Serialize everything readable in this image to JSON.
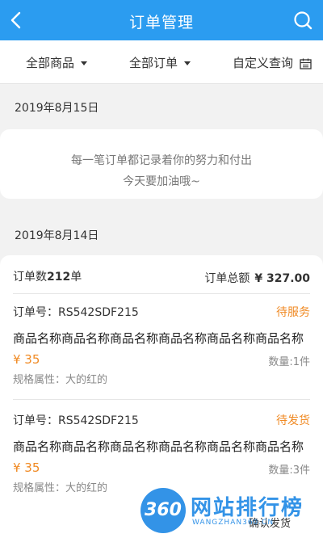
{
  "header": {
    "title": "订单管理"
  },
  "filter": {
    "products": "全部商品",
    "orders": "全部订单",
    "custom_query": "自定义查询"
  },
  "section1": {
    "date": "2019年8月15日",
    "motto_line1": "每一笔订单都记录着你的努力和付出",
    "motto_line2": "今天要加油哦~"
  },
  "section2": {
    "date": "2019年8月14日",
    "summary": {
      "count_label": "订单数",
      "count_value": "212",
      "count_unit": "单",
      "total_label": "订单总额",
      "total_value": "¥ 327.00"
    },
    "orders": [
      {
        "order_no": "订单号：RS542SDF215",
        "status": "待服务",
        "name": "商品名称商品名称商品名称商品名称商品名称商品名称",
        "price": "¥ 35",
        "qty": "数量:1件",
        "spec": "规格属性：大的红的"
      },
      {
        "order_no": "订单号：RS542SDF215",
        "status": "待发货",
        "name": "商品名称商品名称商品名称商品名称商品名称商品名称",
        "price": "¥ 35",
        "qty": "数量:3件",
        "spec": "规格属性：大的红的"
      }
    ],
    "confirm_label": "确认发货"
  },
  "watermark": {
    "logo": "360",
    "text": "网站排行榜",
    "url": "WANGZHAN360.CN"
  },
  "colors": {
    "header_bg": "#2b9cf0",
    "status_orange": "#f08a24",
    "page_bg": "#f2f2f2"
  },
  "icons": [
    "back-arrow-icon",
    "search-icon",
    "caret-down-icon",
    "calendar-icon"
  ]
}
